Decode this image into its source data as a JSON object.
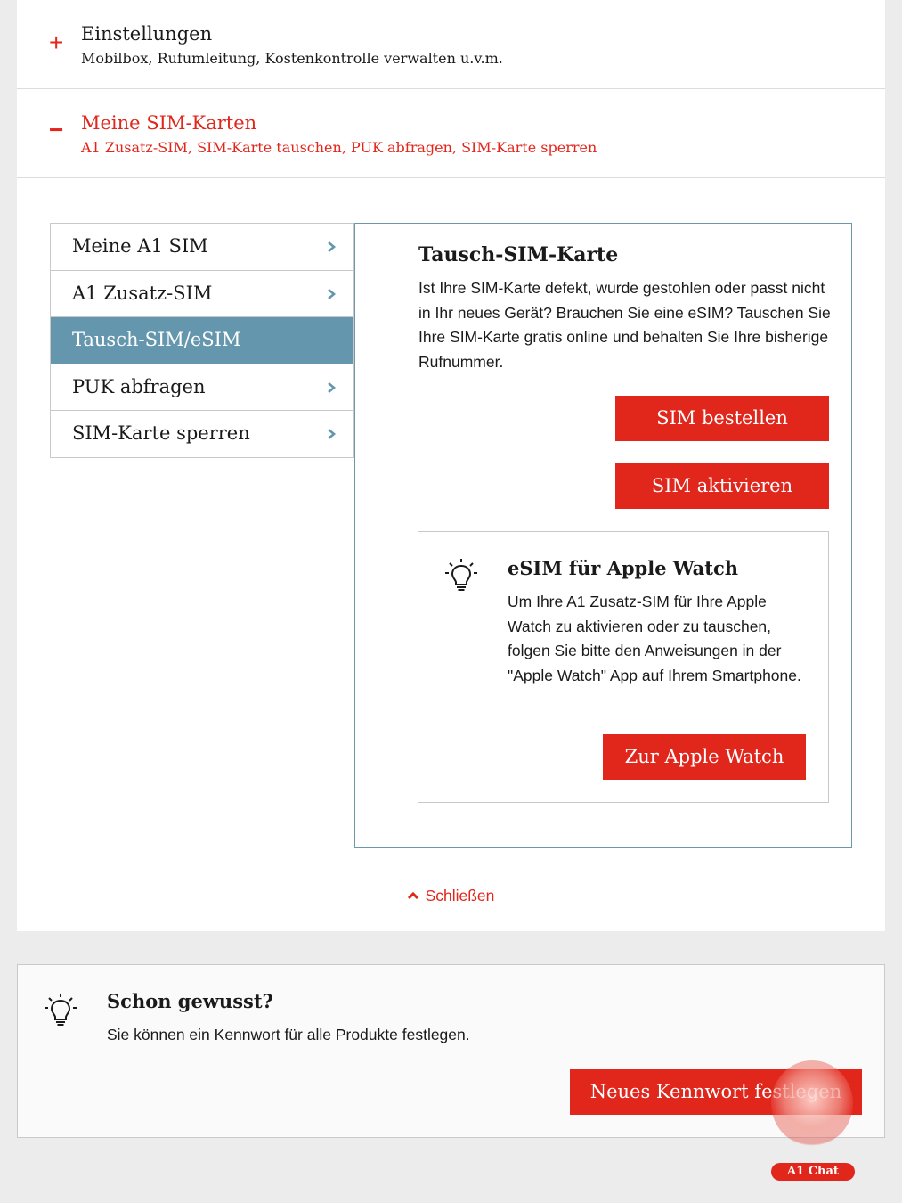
{
  "accordion": {
    "settings": {
      "sign": "+",
      "title": "Einstellungen",
      "subtitle": "Mobilbox, Rufumleitung, Kostenkontrolle verwalten u.v.m."
    },
    "sim": {
      "sign": "−",
      "title": "Meine SIM-Karten",
      "subtitle": "A1 Zusatz-SIM, SIM-Karte tauschen, PUK abfragen, SIM-Karte sperren"
    }
  },
  "menu": {
    "items": [
      {
        "label": "Meine A1 SIM"
      },
      {
        "label": "A1 Zusatz-SIM"
      },
      {
        "label": "Tausch-SIM/eSIM",
        "active": true
      },
      {
        "label": "PUK abfragen"
      },
      {
        "label": "SIM-Karte sperren"
      }
    ]
  },
  "content": {
    "title": "Tausch-SIM-Karte",
    "text": "Ist Ihre SIM-Karte defekt, wurde gestohlen oder passt nicht in Ihr neues Gerät? Brauchen Sie eine eSIM? Tauschen Sie Ihre SIM-Karte gratis online und behalten Sie Ihre bisherige Rufnummer.",
    "btn_order": "SIM bestellen",
    "btn_activate": "SIM aktivieren",
    "esim": {
      "title": "eSIM für Apple Watch",
      "text": "Um Ihre A1 Zusatz-SIM für Ihre Apple Watch zu aktivieren oder zu tauschen, folgen Sie bitte den Anweisungen in der \"Apple Watch\" App auf Ihrem Smartphone.",
      "button": "Zur Apple Watch"
    }
  },
  "close_label": "Schließen",
  "tip": {
    "title": "Schon gewusst?",
    "text": "Sie können ein Kennwort für alle Produkte festlegen.",
    "button": "Neues Kennwort festlegen"
  },
  "chat": {
    "label": "A1 Chat"
  },
  "colors": {
    "accent": "#e1261c",
    "active_tab": "#6497ae",
    "border_blue": "#6d97ab"
  },
  "icons": [
    "plus-icon",
    "minus-icon",
    "chevron-right-icon",
    "lightbulb-icon",
    "chevron-up-icon",
    "chat-icon"
  ]
}
